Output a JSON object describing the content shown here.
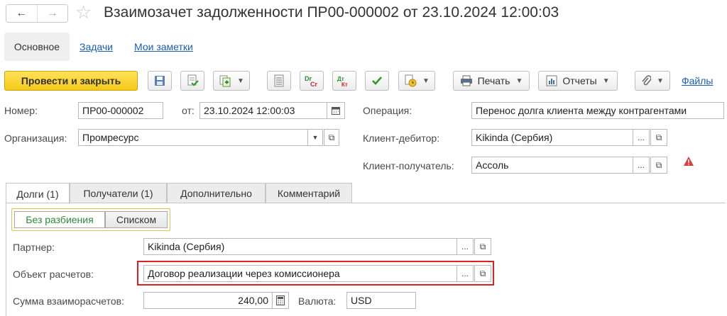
{
  "window": {
    "title": "Взаимозачет задолженности ПР00-000002 от 23.10.2024 12:00:03",
    "back_icon": "arrow-left-icon",
    "forward_icon": "arrow-right-icon",
    "favorite_icon": "star-icon"
  },
  "section_tabs": [
    "Основное",
    "Задачи",
    "Мои заметки"
  ],
  "toolbar": {
    "post_close": "Провести и закрыть",
    "print": "Печать",
    "reports": "Отчеты",
    "files": "Файлы"
  },
  "fields": {
    "number_label": "Номер:",
    "number_value": "ПР00-000002",
    "date_label": "от:",
    "date_value": "23.10.2024 12:00:03",
    "operation_label": "Операция:",
    "operation_value": "Перенос долга клиента между контрагентами",
    "org_label": "Организация:",
    "org_value": "Промресурс",
    "debtor_label": "Клиент-дебитор:",
    "debtor_value": "Kikinda (Сербия)",
    "recipient_label": "Клиент-получатель:",
    "recipient_value": "Ассоль"
  },
  "doc_tabs": [
    "Долги (1)",
    "Получатели (1)",
    "Дополнительно",
    "Комментарий"
  ],
  "debts": {
    "mode_options": [
      "Без разбиения",
      "Списком"
    ],
    "selected_mode": "Без разбиения",
    "partner_label": "Партнер:",
    "partner_value": "Kikinda (Сербия)",
    "object_label": "Объект расчетов:",
    "object_value": "Договор реализации через комиссионера",
    "sum_label": "Сумма взаиморасчетов:",
    "sum_value": "240,00",
    "currency_label": "Валюта:",
    "currency_value": "USD"
  },
  "colors": {
    "accent_yellow": "#f5c917",
    "link_blue": "#1a5fb4",
    "highlight_red": "#e02020",
    "mode_green": "#2e8b3a"
  }
}
